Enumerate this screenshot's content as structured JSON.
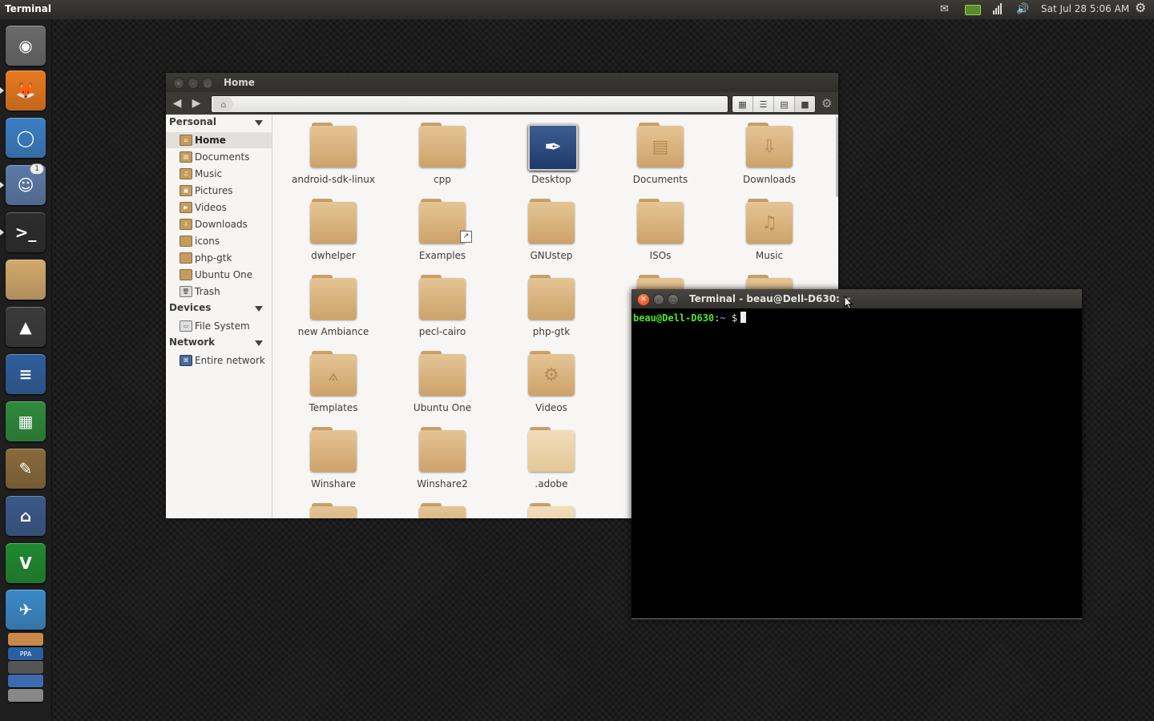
{
  "top_panel": {
    "app_title": "Terminal",
    "clock": "Sat Jul 28  5:06 AM",
    "indicators": {
      "mail": "✉",
      "battery": "▭",
      "network": "▮",
      "volume": "🔊",
      "session": "⚙"
    }
  },
  "launcher": {
    "items": [
      {
        "name": "ubuntu-home-button",
        "glyph": "◉",
        "color": "#6a6a6a"
      },
      {
        "name": "firefox-launcher",
        "glyph": "🦊",
        "color": "#e87a1e"
      },
      {
        "name": "chromium-launcher",
        "glyph": "◯",
        "color": "#3b7fc4"
      },
      {
        "name": "pidgin-launcher",
        "glyph": "☺",
        "color": "#5c7aa8",
        "badge": "1"
      },
      {
        "name": "terminal-launcher",
        "glyph": ">_",
        "color": "#2c2c2c"
      },
      {
        "name": "files-launcher",
        "glyph": "",
        "color": "#d4aa6d"
      },
      {
        "name": "vlc-launcher",
        "glyph": "▲",
        "color": "#3a3a3a"
      },
      {
        "name": "writer-launcher",
        "glyph": "≡",
        "color": "#2e5f9c"
      },
      {
        "name": "calc-launcher",
        "glyph": "▦",
        "color": "#2f8a3b"
      },
      {
        "name": "gimp-launcher",
        "glyph": "✎",
        "color": "#8a6a3a"
      },
      {
        "name": "jitsi-launcher",
        "glyph": "⌂",
        "color": "#3a5a8a"
      },
      {
        "name": "gvim-launcher",
        "glyph": "V",
        "color": "#1f8a2f"
      },
      {
        "name": "inkscape-launcher",
        "glyph": "✈",
        "color": "#3b8ac8"
      }
    ],
    "small_items": [
      {
        "name": "software-center-launcher",
        "label": "",
        "color": "#c8884a"
      },
      {
        "name": "ppa-launcher",
        "label": "PPA",
        "color": "#2b5fa0"
      },
      {
        "name": "settings-launcher",
        "label": "",
        "color": "#555"
      },
      {
        "name": "workspace-switcher-launcher",
        "label": "",
        "color": "#3c6bb0"
      },
      {
        "name": "trash-launcher",
        "label": "",
        "color": "#888"
      }
    ]
  },
  "file_manager": {
    "title": "Home",
    "sidebar": {
      "sections": [
        {
          "label": "Personal",
          "items": [
            {
              "label": "Home",
              "icon": "home-icon",
              "glyph": "⌂",
              "selected": true
            },
            {
              "label": "Documents",
              "icon": "documents-folder-icon",
              "glyph": "▤"
            },
            {
              "label": "Music",
              "icon": "music-folder-icon",
              "glyph": "♫"
            },
            {
              "label": "Pictures",
              "icon": "pictures-folder-icon",
              "glyph": "▣"
            },
            {
              "label": "Videos",
              "icon": "videos-folder-icon",
              "glyph": "▶"
            },
            {
              "label": "Downloads",
              "icon": "downloads-folder-icon",
              "glyph": "⇩"
            },
            {
              "label": "icons",
              "icon": "folder-icon",
              "glyph": ""
            },
            {
              "label": "php-gtk",
              "icon": "folder-icon",
              "glyph": ""
            },
            {
              "label": "Ubuntu One",
              "icon": "folder-icon",
              "glyph": ""
            },
            {
              "label": "Trash",
              "icon": "trash-icon",
              "glyph": "🗑"
            }
          ]
        },
        {
          "label": "Devices",
          "items": [
            {
              "label": "File System",
              "icon": "drive-icon",
              "glyph": "▭"
            }
          ]
        },
        {
          "label": "Network",
          "items": [
            {
              "label": "Entire network",
              "icon": "network-icon",
              "glyph": "⌘"
            }
          ]
        }
      ]
    },
    "files": [
      {
        "label": "android-sdk-linux",
        "kind": "folder"
      },
      {
        "label": "cpp",
        "kind": "folder"
      },
      {
        "label": "Desktop",
        "kind": "desktop"
      },
      {
        "label": "Documents",
        "kind": "folder",
        "emblem": "▤"
      },
      {
        "label": "Downloads",
        "kind": "folder",
        "emblem": "⇩"
      },
      {
        "label": "dwhelper",
        "kind": "folder"
      },
      {
        "label": "Examples",
        "kind": "folder-link"
      },
      {
        "label": "GNUstep",
        "kind": "folder"
      },
      {
        "label": "ISOs",
        "kind": "folder"
      },
      {
        "label": "Music",
        "kind": "folder",
        "emblem": "♫"
      },
      {
        "label": "new Ambiance",
        "kind": "folder"
      },
      {
        "label": "pecl-cairo",
        "kind": "folder"
      },
      {
        "label": "php-gtk",
        "kind": "folder"
      },
      {
        "label": "",
        "kind": "folder"
      },
      {
        "label": "",
        "kind": "folder"
      },
      {
        "label": "Templates",
        "kind": "folder",
        "emblem": "⟑"
      },
      {
        "label": "Ubuntu One",
        "kind": "folder"
      },
      {
        "label": "Videos",
        "kind": "folder",
        "emblem": "⚙"
      },
      {
        "label": "",
        "kind": "none"
      },
      {
        "label": "",
        "kind": "none"
      },
      {
        "label": "Winshare",
        "kind": "folder"
      },
      {
        "label": "Winshare2",
        "kind": "folder"
      },
      {
        "label": ".adobe",
        "kind": "folder-light"
      },
      {
        "label": "",
        "kind": "none"
      },
      {
        "label": "",
        "kind": "none"
      },
      {
        "label": "",
        "kind": "folder"
      },
      {
        "label": "",
        "kind": "folder"
      },
      {
        "label": "",
        "kind": "folder-light"
      }
    ]
  },
  "terminal": {
    "title": "Terminal - beau@Dell-D630: ~",
    "prompt_user": "beau@Dell-D630",
    "prompt_colon": ":",
    "prompt_path": "~",
    "prompt_symbol": "$"
  }
}
